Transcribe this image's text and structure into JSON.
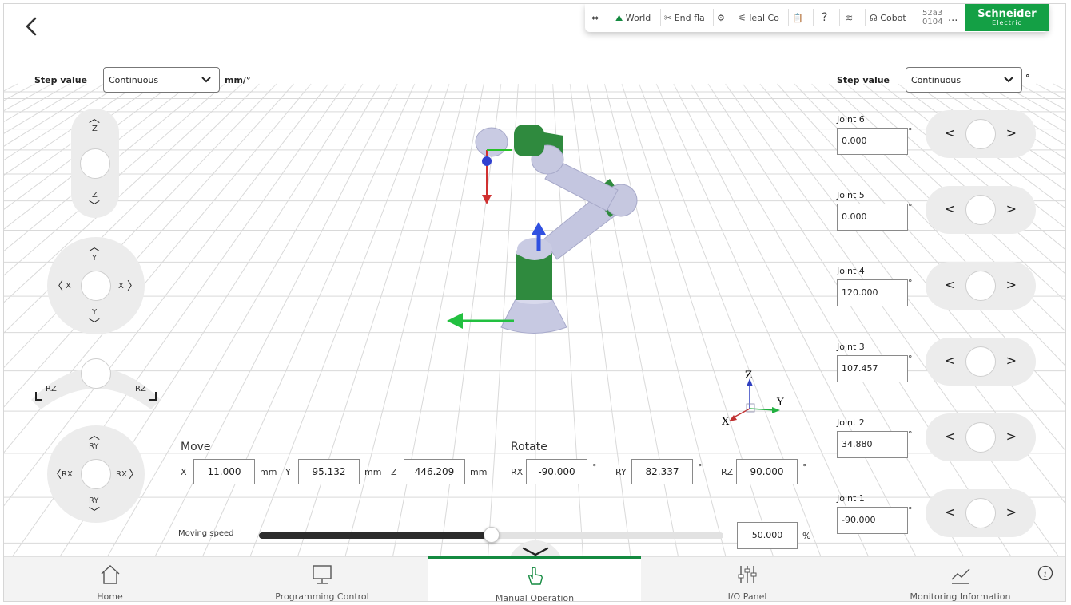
{
  "left": {
    "step_label": "Step value",
    "step_value": "Continuous",
    "step_unit": "mm/°",
    "z_up": "Z",
    "z_down": "Z",
    "y_up": "Y",
    "y_down": "Y",
    "x_left": "X",
    "x_right": "X",
    "rz_left": "RZ",
    "rz_right": "RZ",
    "ry_up": "RY",
    "ry_down": "RY",
    "rx_left": "RX",
    "rx_right": "RX"
  },
  "move": {
    "title": "Move",
    "x_label": "X",
    "x_value": "11.000",
    "x_unit": "mm",
    "y_label": "Y",
    "y_value": "95.132",
    "y_unit": "mm",
    "z_label": "Z",
    "z_value": "446.209",
    "z_unit": "mm"
  },
  "rotate": {
    "title": "Rotate",
    "rx_label": "RX",
    "rx_value": "-90.000",
    "rx_unit": "°",
    "ry_label": "RY",
    "ry_value": "82.337",
    "ry_unit": "°",
    "rz_label": "RZ",
    "rz_value": "90.000",
    "rz_unit": "°"
  },
  "speed": {
    "label": "Moving speed",
    "value": "50.000",
    "unit": "%",
    "fraction": 0.5
  },
  "right": {
    "step_label": "Step value",
    "step_value": "Continuous",
    "step_unit": "°",
    "joint_unit": "°",
    "joints": [
      {
        "label": "Joint 6",
        "value": "0.000"
      },
      {
        "label": "Joint 5",
        "value": "0.000"
      },
      {
        "label": "Joint 4",
        "value": "120.000"
      },
      {
        "label": "Joint 3",
        "value": "107.457"
      },
      {
        "label": "Joint 2",
        "value": "34.880"
      },
      {
        "label": "Joint 1",
        "value": "-90.000"
      }
    ]
  },
  "toolbar": {
    "world": "World",
    "end_flange": "End fla",
    "ideal_co": "leal Co",
    "help": "?",
    "cobot": "Cobot",
    "code_top": "52a3",
    "code_bottom": "0104",
    "more": "...",
    "brand_top": "Schneider",
    "brand_bottom": "Electric"
  },
  "axis_widget": {
    "z": "Z",
    "y": "Y",
    "x": "X"
  },
  "nav": {
    "home": "Home",
    "programming": "Programming Control",
    "manual": "Manual Operation",
    "io": "I/O Panel",
    "monitoring": "Monitoring Information"
  },
  "colors": {
    "accent": "#148a40",
    "brand": "#14a045",
    "arm_green": "#2f8a3e"
  }
}
